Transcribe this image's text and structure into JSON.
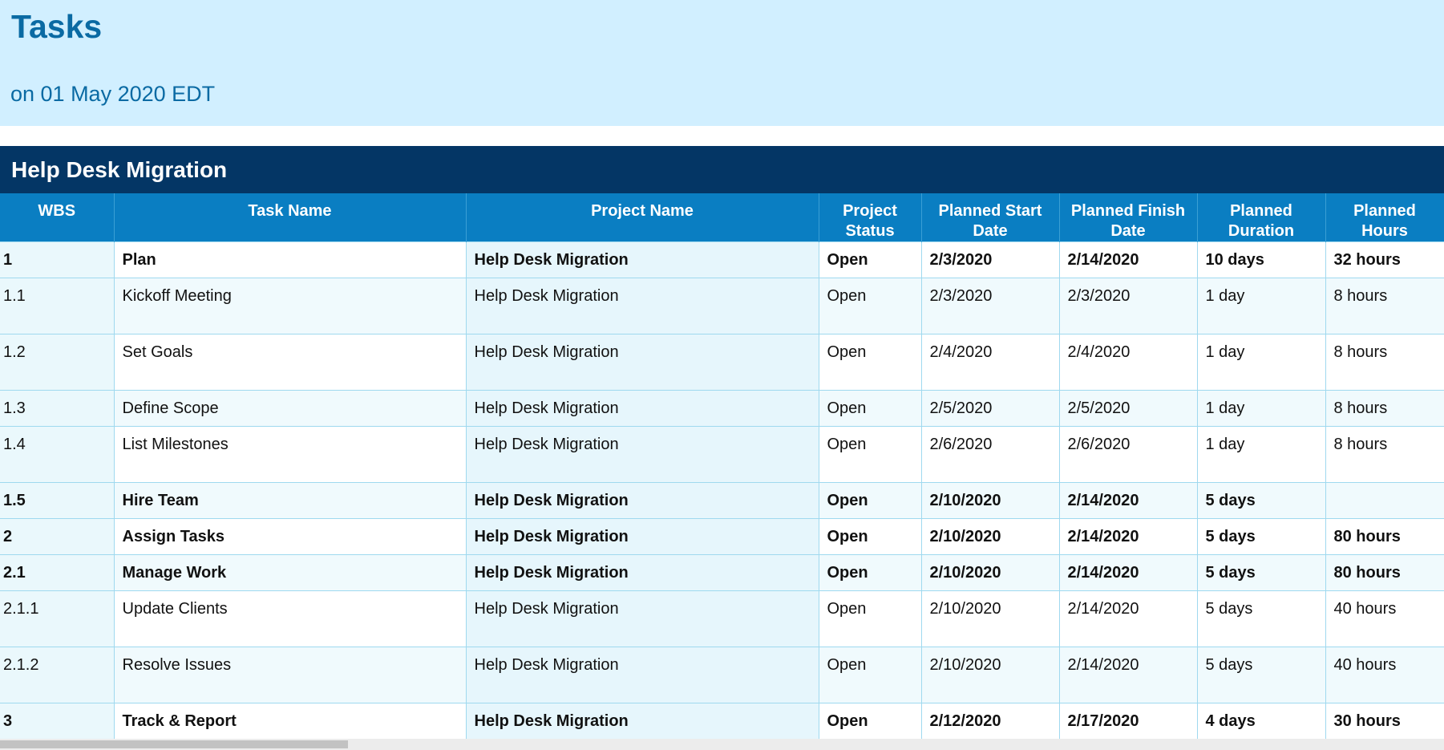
{
  "report": {
    "title": "Tasks",
    "subtitle": "on 01 May 2020 EDT"
  },
  "project": {
    "name": "Help Desk Migration"
  },
  "columns": [
    {
      "key": "wbs",
      "label": "WBS"
    },
    {
      "key": "task",
      "label": "Task Name"
    },
    {
      "key": "project",
      "label": "Project Name"
    },
    {
      "key": "status",
      "label": "Project Status"
    },
    {
      "key": "start",
      "label": "Planned Start Date"
    },
    {
      "key": "finish",
      "label": "Planned Finish Date"
    },
    {
      "key": "duration",
      "label": "Planned Duration"
    },
    {
      "key": "hours",
      "label": "Planned Hours"
    }
  ],
  "rows": [
    {
      "wbs": "1",
      "task": "Plan",
      "project": "Help Desk Migration",
      "status": "Open",
      "start": "2/3/2020",
      "finish": "2/14/2020",
      "duration": "10 days",
      "hours": "32 hours",
      "summary": true,
      "tall": false
    },
    {
      "wbs": "1.1",
      "task": "Kickoff Meeting",
      "project": "Help Desk Migration",
      "status": "Open",
      "start": "2/3/2020",
      "finish": "2/3/2020",
      "duration": "1 day",
      "hours": "8 hours",
      "summary": false,
      "tall": true
    },
    {
      "wbs": "1.2",
      "task": "Set Goals",
      "project": "Help Desk Migration",
      "status": "Open",
      "start": "2/4/2020",
      "finish": "2/4/2020",
      "duration": "1 day",
      "hours": "8 hours",
      "summary": false,
      "tall": true
    },
    {
      "wbs": "1.3",
      "task": "Define Scope",
      "project": "Help Desk Migration",
      "status": "Open",
      "start": "2/5/2020",
      "finish": "2/5/2020",
      "duration": "1 day",
      "hours": "8 hours",
      "summary": false,
      "tall": false
    },
    {
      "wbs": "1.4",
      "task": "List Milestones",
      "project": "Help Desk Migration",
      "status": "Open",
      "start": "2/6/2020",
      "finish": "2/6/2020",
      "duration": "1 day",
      "hours": "8 hours",
      "summary": false,
      "tall": true
    },
    {
      "wbs": "1.5",
      "task": "Hire Team",
      "project": "Help Desk Migration",
      "status": "Open",
      "start": "2/10/2020",
      "finish": "2/14/2020",
      "duration": "5 days",
      "hours": "",
      "summary": true,
      "tall": false
    },
    {
      "wbs": "2",
      "task": "Assign Tasks",
      "project": "Help Desk Migration",
      "status": "Open",
      "start": "2/10/2020",
      "finish": "2/14/2020",
      "duration": "5 days",
      "hours": "80 hours",
      "summary": true,
      "tall": false
    },
    {
      "wbs": "2.1",
      "task": "Manage Work",
      "project": "Help Desk Migration",
      "status": "Open",
      "start": "2/10/2020",
      "finish": "2/14/2020",
      "duration": "5 days",
      "hours": "80 hours",
      "summary": true,
      "tall": false
    },
    {
      "wbs": "2.1.1",
      "task": "Update Clients",
      "project": "Help Desk Migration",
      "status": "Open",
      "start": "2/10/2020",
      "finish": "2/14/2020",
      "duration": "5 days",
      "hours": "40 hours",
      "summary": false,
      "tall": true
    },
    {
      "wbs": "2.1.2",
      "task": "Resolve Issues",
      "project": "Help Desk Migration",
      "status": "Open",
      "start": "2/10/2020",
      "finish": "2/14/2020",
      "duration": "5 days",
      "hours": "40 hours",
      "summary": false,
      "tall": true
    },
    {
      "wbs": "3",
      "task": "Track & Report",
      "project": "Help Desk Migration",
      "status": "Open",
      "start": "2/12/2020",
      "finish": "2/17/2020",
      "duration": "4 days",
      "hours": "30 hours",
      "summary": true,
      "tall": false
    }
  ],
  "colors": {
    "header_bg": "#d1efff",
    "title_text": "#0a6aa3",
    "project_bar": "#043665",
    "column_header": "#0a7ec2",
    "grid_line": "#9fd9ef"
  }
}
